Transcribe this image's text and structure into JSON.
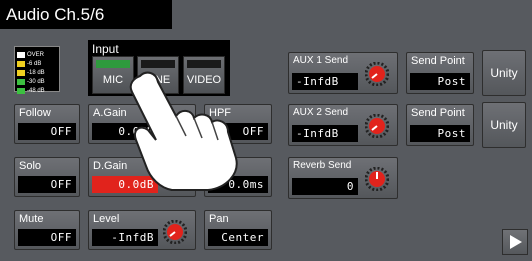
{
  "title": "Audio Ch.5/6",
  "meter_legend": [
    {
      "label": "OVER",
      "color": "#ffffff"
    },
    {
      "label": "-6 dB",
      "color": "#f0d020"
    },
    {
      "label": "-18 dB",
      "color": "#f0d020"
    },
    {
      "label": "-30 dB",
      "color": "#3cc040"
    },
    {
      "label": "-48 dB",
      "color": "#3cc040"
    }
  ],
  "input": {
    "label": "Input",
    "options": [
      "MIC",
      "LINE",
      "VIDEO"
    ],
    "selected": "MIC"
  },
  "follow": {
    "label": "Follow",
    "value": "OFF"
  },
  "solo": {
    "label": "Solo",
    "value": "OFF"
  },
  "mute": {
    "label": "Mute",
    "value": "OFF"
  },
  "again": {
    "label": "A.Gain",
    "value": "0.0dB"
  },
  "dgain": {
    "label": "D.Gain",
    "value": "0.0dB"
  },
  "level": {
    "label": "Level",
    "value": "-InfdB"
  },
  "hpf": {
    "label": "HPF",
    "value": "OFF"
  },
  "delay": {
    "label": "",
    "value": "0.0ms"
  },
  "pan": {
    "label": "Pan",
    "value": "Center"
  },
  "aux1": {
    "label": "AUX 1 Send",
    "value": "-InfdB"
  },
  "aux2": {
    "label": "AUX 2 Send",
    "value": "-InfdB"
  },
  "reverb": {
    "label": "Reverb Send",
    "value": "0"
  },
  "sendpoint1": {
    "label": "Send Point",
    "value": "Post"
  },
  "sendpoint2": {
    "label": "Send Point",
    "value": "Post"
  },
  "unity1": "Unity",
  "unity2": "Unity",
  "colors": {
    "accent_red": "#e1231c",
    "active_green": "#2e9a3d"
  }
}
